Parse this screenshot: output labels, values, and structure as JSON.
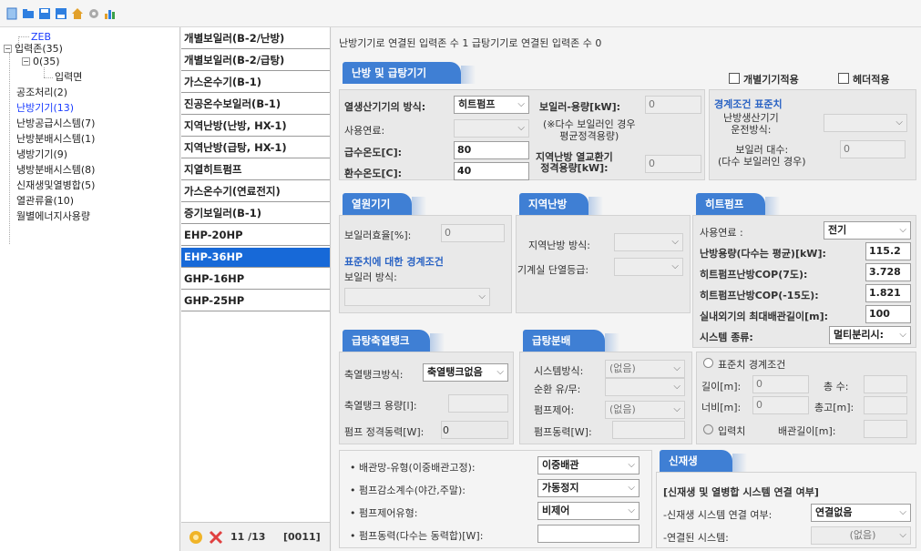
{
  "toolbar": {
    "icons": [
      "new-doc-icon",
      "open-folder-icon",
      "save-icon",
      "save-as-icon",
      "home-icon",
      "settings-gear-icon",
      "chart-icon"
    ]
  },
  "tree": {
    "items": [
      {
        "label": "ZEB"
      },
      {
        "label": "입력존(35)"
      },
      {
        "label": "0(35)"
      },
      {
        "label": "입력면"
      },
      {
        "label": "공조처리(2)"
      },
      {
        "label": "난방기기(13)"
      },
      {
        "label": "난방공급시스템(7)"
      },
      {
        "label": "난방분배시스템(1)"
      },
      {
        "label": "냉방기기(9)"
      },
      {
        "label": "냉방분배시스템(8)"
      },
      {
        "label": "신재생및열병합(5)"
      },
      {
        "label": "열관류율(10)"
      },
      {
        "label": "월별에너지사용량"
      }
    ]
  },
  "list": {
    "items": [
      {
        "label": "개별보일러(B-2/난방)"
      },
      {
        "label": "개별보일러(B-2/급탕)"
      },
      {
        "label": "가스온수기(B-1)"
      },
      {
        "label": "진공온수보일러(B-1)"
      },
      {
        "label": "지역난방(난방, HX-1)"
      },
      {
        "label": "지역난방(급탕, HX-1)"
      },
      {
        "label": "지열히트펌프"
      },
      {
        "label": "가스온수기(연료전지)"
      },
      {
        "label": "증기보일러(B-1)"
      },
      {
        "label": "EHP-20HP"
      },
      {
        "label": "EHP-36HP"
      },
      {
        "label": "GHP-16HP"
      },
      {
        "label": "GHP-25HP"
      }
    ],
    "footer": {
      "counter": "11 /13",
      "code": "[0011]"
    }
  },
  "main": {
    "header": "난방기기로 연결된 입력존 수 1 급탕기기로 연결된 입력존 수 0",
    "heating_tab": "난방 및 급탕기기",
    "individual_check": "개별기기적용",
    "header_check": "헤더적용",
    "heat_method_label": "열생산기기의 방식:",
    "heat_method_value": "히트펌프",
    "boiler_capacity_label": "보일러-용량[kW]:",
    "boiler_capacity_value": "0",
    "fuel_label": "사용연료:",
    "multi_note": "(※다수 보일러인 경우\n평균정격용량)",
    "supply_temp_label": "급수온도[C]:",
    "supply_temp_value": "80",
    "district_capacity_label": "지역난방 열교환기\n정격용량[kW]:",
    "district_capacity_value": "0",
    "return_temp_label": "환수온도[C]:",
    "return_temp_value": "40",
    "boundary_title": "경계조건 표준치",
    "boundary_method_label": "난방생산기기\n운전방식:",
    "boiler_count_label": "보일러 대수:\n(다수 보일러인 경우)",
    "boiler_count_value": "0",
    "heat_source_tab": "열원기기",
    "boiler_eff_label": "보일러효율[%]:",
    "boiler_eff_value": "0",
    "std_boundary_label": "표준치에 대한 경계조건",
    "boiler_type_label": "보일러 방식:",
    "district_tab": "지역난방",
    "district_method_label": "지역난방 방식:",
    "machine_room_label": "기계실 단열등급:",
    "heatpump_tab": "히트펌프",
    "hp_fuel_label": "사용연료 :",
    "hp_fuel_value": "전기",
    "hp_capacity_label": "난방용량(다수는 평균)[kW]:",
    "hp_capacity_value": "115.2",
    "hp_cop7_label": "히트펌프난방COP(7도):",
    "hp_cop7_value": "3.728",
    "hp_cop15_label": "히트펌프난방COP(-15도):",
    "hp_cop15_value": "1.821",
    "hp_pipe_label": "실내외기의 최대배관길이[m]:",
    "hp_pipe_value": "100",
    "hp_system_label": "시스템 종류:",
    "hp_system_value": "멀티분리시:",
    "storage_tab": "급탕축열탱크",
    "storage_method_label": "축열탱크방식:",
    "storage_method_value": "축열탱크없음",
    "storage_cap_label": "축열탱크 용량[l]:",
    "pump_rated_label": "펌프 정격동력[W]:",
    "pump_rated_value": "0",
    "dist_tab": "급탕분배",
    "dist_system_label": "시스템방식:",
    "dist_system_value": "(없음)",
    "circ_label": "순환 유/무:",
    "pump_ctrl_label": "펌프제어:",
    "pump_ctrl_value": "(없음)",
    "pump_power_label": "펌프동력[W]:",
    "std_radio_label": "표준치 경계조건",
    "length_label": "길이[m]:",
    "length_value": "0",
    "total_count_label": "총 수:",
    "width_label": "너비[m]:",
    "width_value": "0",
    "total_height_label": "총고[m]:",
    "input_radio_label": "입력치",
    "pipe_length_label": "배관길이[m]:",
    "pipe_type_label": "• 배관망-유형(이중배관고정):",
    "pipe_type_value": "이중배관",
    "pump_reduce_label": "• 펌프감소계수(야간,주말):",
    "pump_reduce_value": "가동정지",
    "pump_ctrl_type_label": "• 펌프제어유형:",
    "pump_ctrl_type_value": "비제어",
    "pump_power_sum_label": "• 펌프동력(다수는 동력합)[W]:",
    "renew_tab": "신재생",
    "renew_title": "[신재생 및 열병합 시스템 연결 여부]",
    "renew_conn_label": "-신재생 시스템 연결 여부:",
    "renew_conn_value": "연결없음",
    "renew_linked_label": "-연결된 시스템:",
    "renew_linked_value": "(없음)"
  }
}
